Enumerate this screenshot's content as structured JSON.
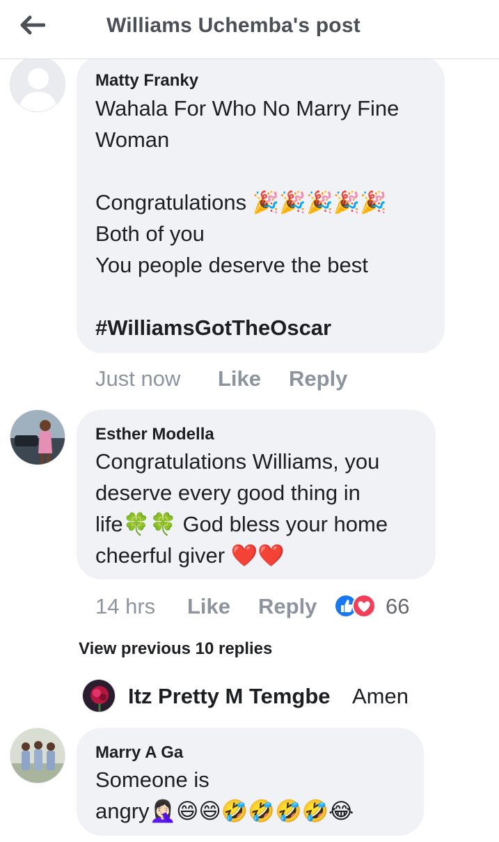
{
  "header": {
    "title": "Williams Uchemba's post",
    "back_icon": "arrow-left-icon"
  },
  "comments": [
    {
      "author": "Matty Franky",
      "lines": [
        "Wahala For Who No Marry Fine",
        "Woman",
        "",
        "Congratulations 🎉🎉🎉🎉🎉",
        "Both of you",
        "You people deserve the best",
        "",
        "#WilliamsGotTheOscar"
      ],
      "time": "Just now",
      "like_label": "Like",
      "reply_label": "Reply"
    },
    {
      "author": "Esther Modella",
      "lines": [
        "Congratulations Williams, you",
        "deserve every good thing in",
        "life🍀🍀 God bless your home",
        "cheerful giver ❤️❤️"
      ],
      "time": "14 hrs",
      "like_label": "Like",
      "reply_label": "Reply",
      "reaction_icons": [
        "like-reaction-icon",
        "love-reaction-icon"
      ],
      "reaction_count": "66"
    },
    {
      "author": "Marry A Ga",
      "lines": [
        "Someone is",
        "angry🤦🏻‍♀️😄😄🤣🤣🤣🤣😂"
      ]
    }
  ],
  "replies": {
    "view_previous_label": "View previous 10 replies",
    "items": [
      {
        "author": "Itz Pretty M Temgbe",
        "text": "Amen"
      }
    ]
  },
  "colors": {
    "bubble": "#f0f2f5",
    "meta_text": "#8d949e",
    "like_blue": "#1877f2",
    "love_red": "#f33e58"
  }
}
